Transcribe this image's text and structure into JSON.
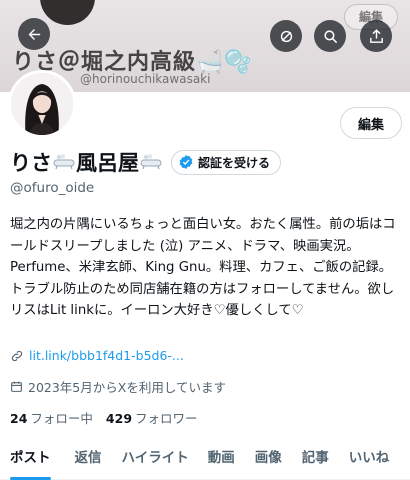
{
  "header": {
    "banner_title": "りさ＠堀之内高級🛁🫧",
    "banner_subtitle": "@horinouchikawasaki",
    "banner_tag": "編集",
    "buttons": [
      "back-arrow-icon",
      "hide-icon",
      "search-icon",
      "share-icon"
    ]
  },
  "profile": {
    "edit_label": "編集",
    "name_part1": "りさ",
    "name_part2": "風呂屋",
    "verify_label": "認証を受ける",
    "handle": "@ofuro_oide",
    "bio": "堀之内の片隅にいるちょっと面白い女。おたく属性。前の垢はコールドスリープしました (泣) アニメ、ドラマ、映画実況。Perfume、米津玄師、King Gnu。料理、カフェ、ご飯の記録。トラブル防止のため同店舗在籍の方はフォローしてません。欲しリスはLit linkに。イーロン大好き♡優しくして♡",
    "link": "lit.link/bbb1f4d1-b5d6-...",
    "joined": "2023年5月からXを利用しています",
    "following_count": "24",
    "following_label": "フォロー中",
    "followers_count": "429",
    "followers_label": "フォロワー"
  },
  "tabs": [
    {
      "label": "ポスト",
      "active": true
    },
    {
      "label": "返信"
    },
    {
      "label": "ハイライト"
    },
    {
      "label": "動画"
    },
    {
      "label": "画像"
    },
    {
      "label": "記事"
    },
    {
      "label": "いいね"
    }
  ],
  "colors": {
    "accent": "#1d9bf0",
    "text": "#0f1419",
    "muted": "#536471",
    "border": "#cfd9de"
  }
}
